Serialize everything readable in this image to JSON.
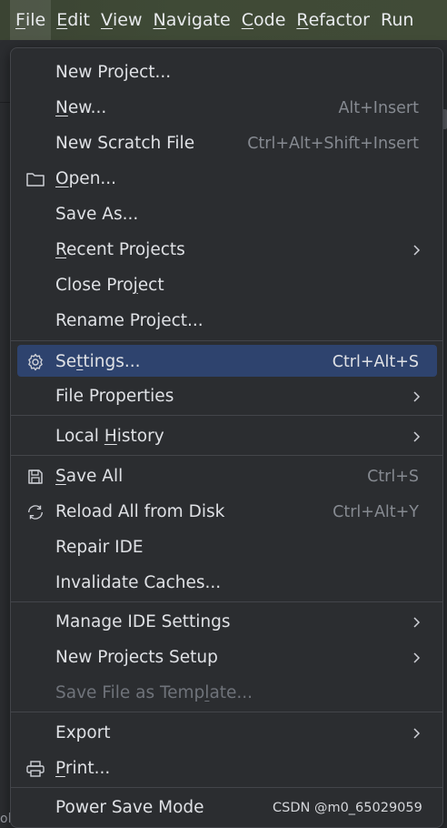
{
  "menubar": {
    "items": [
      {
        "pre": "",
        "u": "F",
        "post": "ile"
      },
      {
        "pre": "",
        "u": "E",
        "post": "dit"
      },
      {
        "pre": "",
        "u": "V",
        "post": "iew"
      },
      {
        "pre": "",
        "u": "N",
        "post": "avigate"
      },
      {
        "pre": "",
        "u": "C",
        "post": "ode"
      },
      {
        "pre": "",
        "u": "R",
        "post": "efactor"
      },
      {
        "pre": "Ru",
        "u": "",
        "post": "n"
      }
    ]
  },
  "file_menu": {
    "items": [
      {
        "pre": "New Project...",
        "u": "",
        "post": "",
        "shortcut": ""
      },
      {
        "pre": "",
        "u": "N",
        "post": "ew...",
        "shortcut": "Alt+Insert"
      },
      {
        "pre": "New Scratch File",
        "u": "",
        "post": "",
        "shortcut": "Ctrl+Alt+Shift+Insert"
      },
      {
        "pre": "",
        "u": "O",
        "post": "pen...",
        "shortcut": ""
      },
      {
        "pre": "Save As...",
        "u": "",
        "post": "",
        "shortcut": ""
      },
      {
        "pre": "",
        "u": "R",
        "post": "ecent Projects",
        "shortcut": ""
      },
      {
        "pre": "Close Pro",
        "u": "j",
        "post": "ect",
        "shortcut": ""
      },
      {
        "pre": "Rename Project...",
        "u": "",
        "post": "",
        "shortcut": ""
      },
      {
        "pre": "Se",
        "u": "t",
        "post": "tings...",
        "shortcut": "Ctrl+Alt+S"
      },
      {
        "pre": "File Properties",
        "u": "",
        "post": "",
        "shortcut": ""
      },
      {
        "pre": "Local ",
        "u": "H",
        "post": "istory",
        "shortcut": ""
      },
      {
        "pre": "",
        "u": "S",
        "post": "ave All",
        "shortcut": "Ctrl+S"
      },
      {
        "pre": "Reload All from Disk",
        "u": "",
        "post": "",
        "shortcut": "Ctrl+Alt+Y"
      },
      {
        "pre": "Repair IDE",
        "u": "",
        "post": "",
        "shortcut": ""
      },
      {
        "pre": "Invalidate Caches...",
        "u": "",
        "post": "",
        "shortcut": ""
      },
      {
        "pre": "Manage IDE Settings",
        "u": "",
        "post": "",
        "shortcut": ""
      },
      {
        "pre": "New Projects Setup",
        "u": "",
        "post": "",
        "shortcut": ""
      },
      {
        "pre": "Save File as Temp",
        "u": "l",
        "post": "ate...",
        "shortcut": ""
      },
      {
        "pre": "Export",
        "u": "",
        "post": "",
        "shortcut": ""
      },
      {
        "pre": "",
        "u": "P",
        "post": "rint...",
        "shortcut": ""
      },
      {
        "pre": "Power Save Mode",
        "u": "",
        "post": "",
        "shortcut": ""
      }
    ]
  },
  "icons": {
    "open": "folder-icon",
    "settings": "gear-icon",
    "save_all": "floppy-disk-icon",
    "reload": "reload-icon",
    "print": "printer-icon",
    "submenu": "chevron-right-icon"
  },
  "colors": {
    "menu_bg": "#2b2d30",
    "selection": "#2e436e",
    "text": "#dfe1e5",
    "shortcut_text": "#868a91",
    "disabled_text": "#6f737a",
    "separator": "#43454a"
  },
  "watermark": "CSDN @m0_65029059",
  "left_edge_glyph": "ol"
}
